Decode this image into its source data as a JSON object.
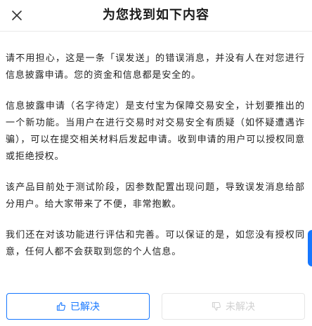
{
  "header": {
    "title": "为您找到如下内容",
    "close_icon": "close-icon"
  },
  "content": {
    "paragraphs": [
      "请不用担心，这是一条「误发送」的错误消息，并没有人在对您进行信息披露申请。您的资金和信息都是安全的。",
      "信息披露申请（名字待定）是支付宝为保障交易安全，计划要推出的一个新功能。当用户在进行交易时对交易安全有质疑（如怀疑遭遇诈骗），可以在提交相关材料后发起申请。收到申请的用户可以授权同意或拒绝授权。",
      "该产品目前处于测试阶段，因参数配置出现问题，导致误发消息给部分用户。给大家带来了不便，非常抱歉。",
      "我们还在对该功能进行评估和完善。可以保证的是，如您没有授权同意，任何人都不会获取到您的个人信息。"
    ]
  },
  "footer": {
    "resolved_label": "已解决",
    "resolved_icon": "thumbs-up-icon",
    "unresolved_label": "未解决",
    "unresolved_icon": "thumbs-down-icon"
  },
  "colors": {
    "accent": "#1677ff",
    "text": "#222222",
    "disabled": "#d0d0d0"
  }
}
